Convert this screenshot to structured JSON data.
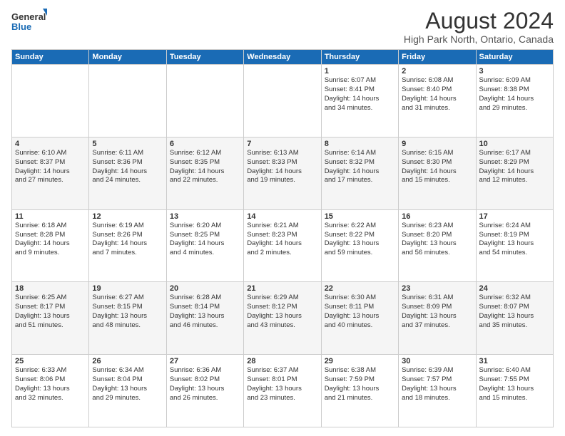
{
  "logo": {
    "line1": "General",
    "line2": "Blue"
  },
  "title": "August 2024",
  "subtitle": "High Park North, Ontario, Canada",
  "weekdays": [
    "Sunday",
    "Monday",
    "Tuesday",
    "Wednesday",
    "Thursday",
    "Friday",
    "Saturday"
  ],
  "weeks": [
    [
      {
        "day": "",
        "info": ""
      },
      {
        "day": "",
        "info": ""
      },
      {
        "day": "",
        "info": ""
      },
      {
        "day": "",
        "info": ""
      },
      {
        "day": "1",
        "info": "Sunrise: 6:07 AM\nSunset: 8:41 PM\nDaylight: 14 hours\nand 34 minutes."
      },
      {
        "day": "2",
        "info": "Sunrise: 6:08 AM\nSunset: 8:40 PM\nDaylight: 14 hours\nand 31 minutes."
      },
      {
        "day": "3",
        "info": "Sunrise: 6:09 AM\nSunset: 8:38 PM\nDaylight: 14 hours\nand 29 minutes."
      }
    ],
    [
      {
        "day": "4",
        "info": "Sunrise: 6:10 AM\nSunset: 8:37 PM\nDaylight: 14 hours\nand 27 minutes."
      },
      {
        "day": "5",
        "info": "Sunrise: 6:11 AM\nSunset: 8:36 PM\nDaylight: 14 hours\nand 24 minutes."
      },
      {
        "day": "6",
        "info": "Sunrise: 6:12 AM\nSunset: 8:35 PM\nDaylight: 14 hours\nand 22 minutes."
      },
      {
        "day": "7",
        "info": "Sunrise: 6:13 AM\nSunset: 8:33 PM\nDaylight: 14 hours\nand 19 minutes."
      },
      {
        "day": "8",
        "info": "Sunrise: 6:14 AM\nSunset: 8:32 PM\nDaylight: 14 hours\nand 17 minutes."
      },
      {
        "day": "9",
        "info": "Sunrise: 6:15 AM\nSunset: 8:30 PM\nDaylight: 14 hours\nand 15 minutes."
      },
      {
        "day": "10",
        "info": "Sunrise: 6:17 AM\nSunset: 8:29 PM\nDaylight: 14 hours\nand 12 minutes."
      }
    ],
    [
      {
        "day": "11",
        "info": "Sunrise: 6:18 AM\nSunset: 8:28 PM\nDaylight: 14 hours\nand 9 minutes."
      },
      {
        "day": "12",
        "info": "Sunrise: 6:19 AM\nSunset: 8:26 PM\nDaylight: 14 hours\nand 7 minutes."
      },
      {
        "day": "13",
        "info": "Sunrise: 6:20 AM\nSunset: 8:25 PM\nDaylight: 14 hours\nand 4 minutes."
      },
      {
        "day": "14",
        "info": "Sunrise: 6:21 AM\nSunset: 8:23 PM\nDaylight: 14 hours\nand 2 minutes."
      },
      {
        "day": "15",
        "info": "Sunrise: 6:22 AM\nSunset: 8:22 PM\nDaylight: 13 hours\nand 59 minutes."
      },
      {
        "day": "16",
        "info": "Sunrise: 6:23 AM\nSunset: 8:20 PM\nDaylight: 13 hours\nand 56 minutes."
      },
      {
        "day": "17",
        "info": "Sunrise: 6:24 AM\nSunset: 8:19 PM\nDaylight: 13 hours\nand 54 minutes."
      }
    ],
    [
      {
        "day": "18",
        "info": "Sunrise: 6:25 AM\nSunset: 8:17 PM\nDaylight: 13 hours\nand 51 minutes."
      },
      {
        "day": "19",
        "info": "Sunrise: 6:27 AM\nSunset: 8:15 PM\nDaylight: 13 hours\nand 48 minutes."
      },
      {
        "day": "20",
        "info": "Sunrise: 6:28 AM\nSunset: 8:14 PM\nDaylight: 13 hours\nand 46 minutes."
      },
      {
        "day": "21",
        "info": "Sunrise: 6:29 AM\nSunset: 8:12 PM\nDaylight: 13 hours\nand 43 minutes."
      },
      {
        "day": "22",
        "info": "Sunrise: 6:30 AM\nSunset: 8:11 PM\nDaylight: 13 hours\nand 40 minutes."
      },
      {
        "day": "23",
        "info": "Sunrise: 6:31 AM\nSunset: 8:09 PM\nDaylight: 13 hours\nand 37 minutes."
      },
      {
        "day": "24",
        "info": "Sunrise: 6:32 AM\nSunset: 8:07 PM\nDaylight: 13 hours\nand 35 minutes."
      }
    ],
    [
      {
        "day": "25",
        "info": "Sunrise: 6:33 AM\nSunset: 8:06 PM\nDaylight: 13 hours\nand 32 minutes."
      },
      {
        "day": "26",
        "info": "Sunrise: 6:34 AM\nSunset: 8:04 PM\nDaylight: 13 hours\nand 29 minutes."
      },
      {
        "day": "27",
        "info": "Sunrise: 6:36 AM\nSunset: 8:02 PM\nDaylight: 13 hours\nand 26 minutes."
      },
      {
        "day": "28",
        "info": "Sunrise: 6:37 AM\nSunset: 8:01 PM\nDaylight: 13 hours\nand 23 minutes."
      },
      {
        "day": "29",
        "info": "Sunrise: 6:38 AM\nSunset: 7:59 PM\nDaylight: 13 hours\nand 21 minutes."
      },
      {
        "day": "30",
        "info": "Sunrise: 6:39 AM\nSunset: 7:57 PM\nDaylight: 13 hours\nand 18 minutes."
      },
      {
        "day": "31",
        "info": "Sunrise: 6:40 AM\nSunset: 7:55 PM\nDaylight: 13 hours\nand 15 minutes."
      }
    ]
  ],
  "colors": {
    "header_bg": "#1a6bb5",
    "header_text": "#ffffff",
    "accent": "#1a6bb5"
  }
}
